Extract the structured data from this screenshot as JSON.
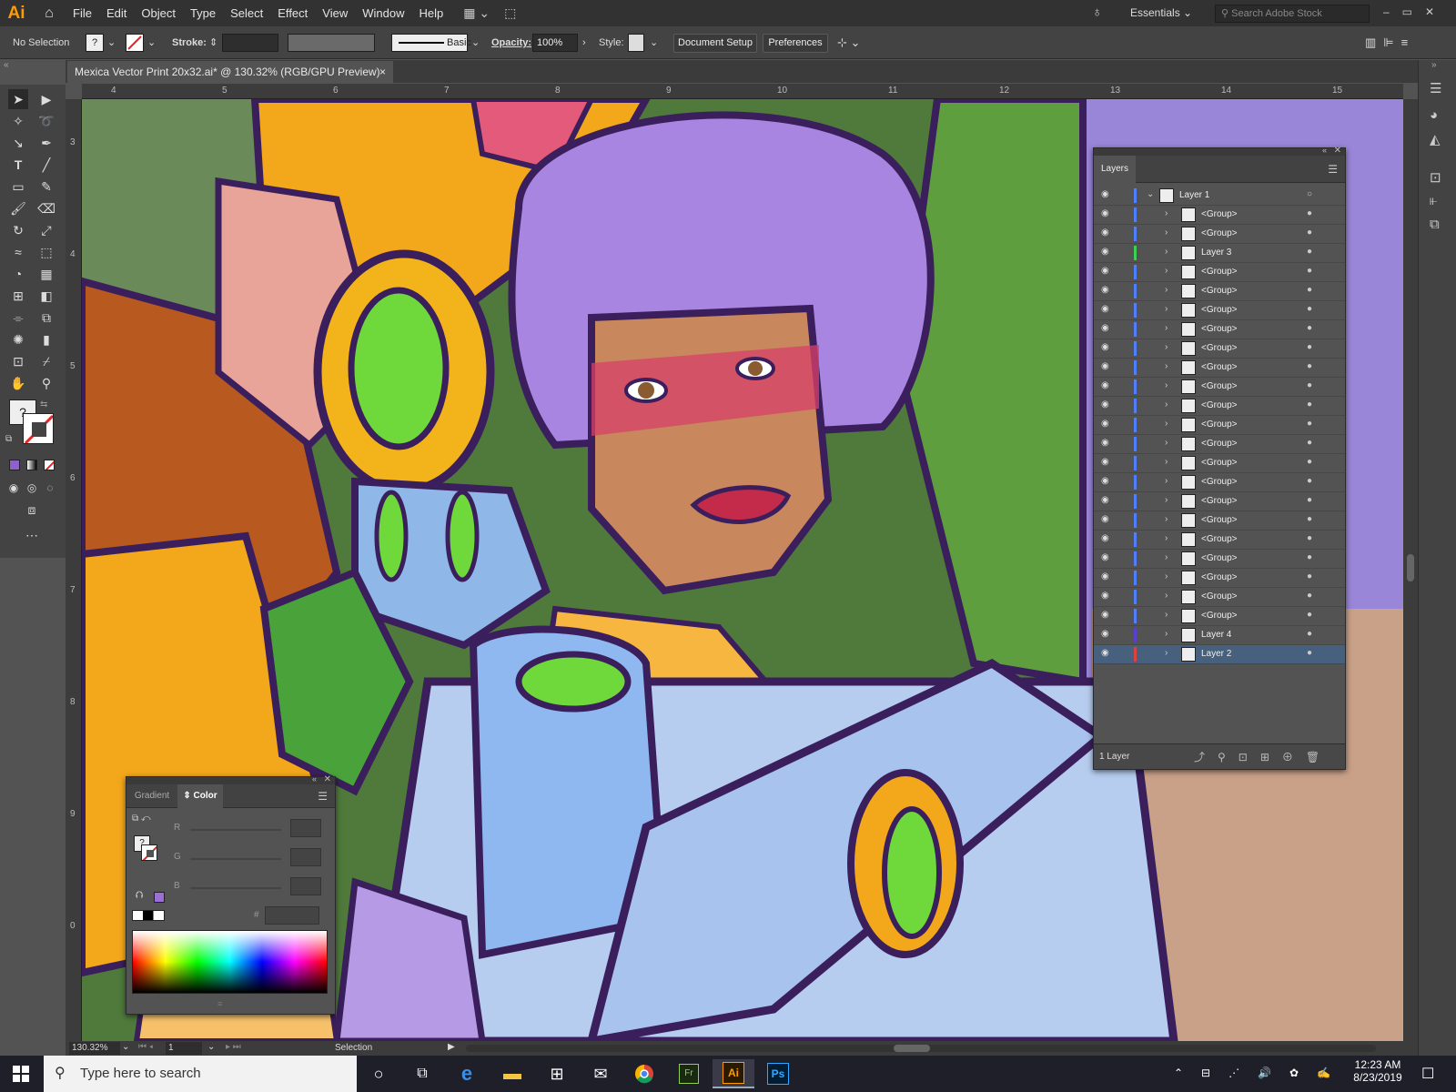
{
  "app": {
    "logo": "Ai",
    "accent": "#ff9a00"
  },
  "menu": [
    "File",
    "Edit",
    "Object",
    "Type",
    "Select",
    "Effect",
    "View",
    "Window",
    "Help"
  ],
  "workspace": {
    "label": "Essentials",
    "search_placeholder": "Search Adobe Stock"
  },
  "control": {
    "selection": "No Selection",
    "fill": "?",
    "stroke_label": "Stroke:",
    "brush": "Basic",
    "opacity_label": "Opacity:",
    "opacity": "100%",
    "style_label": "Style:",
    "doc_setup": "Document Setup",
    "preferences": "Preferences"
  },
  "document": {
    "tab": "Mexica Vector Print 20x32.ai* @ 130.32% (RGB/GPU Preview)",
    "close": "×"
  },
  "ruler_h": [
    "4",
    "5",
    "6",
    "7",
    "8",
    "9",
    "10",
    "11",
    "12",
    "13",
    "14",
    "15"
  ],
  "ruler_v": [
    "3",
    "4",
    "5",
    "6",
    "7",
    "8",
    "9",
    "0"
  ],
  "layers": {
    "tab": "Layers",
    "footer": "1 Layer",
    "rows": [
      {
        "name": "Layer 1",
        "color": "#4f7fff",
        "level": 0
      },
      {
        "name": "<Group>",
        "color": "#4f7fff",
        "level": 1
      },
      {
        "name": "<Group>",
        "color": "#4f7fff",
        "level": 1
      },
      {
        "name": "Layer 3",
        "color": "#3fd04f",
        "level": 1
      },
      {
        "name": "<Group>",
        "color": "#4f7fff",
        "level": 1
      },
      {
        "name": "<Group>",
        "color": "#4f7fff",
        "level": 1
      },
      {
        "name": "<Group>",
        "color": "#4f7fff",
        "level": 1
      },
      {
        "name": "<Group>",
        "color": "#4f7fff",
        "level": 1
      },
      {
        "name": "<Group>",
        "color": "#4f7fff",
        "level": 1
      },
      {
        "name": "<Group>",
        "color": "#4f7fff",
        "level": 1
      },
      {
        "name": "<Group>",
        "color": "#4f7fff",
        "level": 1
      },
      {
        "name": "<Group>",
        "color": "#4f7fff",
        "level": 1
      },
      {
        "name": "<Group>",
        "color": "#4f7fff",
        "level": 1
      },
      {
        "name": "<Group>",
        "color": "#4f7fff",
        "level": 1
      },
      {
        "name": "<Group>",
        "color": "#4f7fff",
        "level": 1
      },
      {
        "name": "<Group>",
        "color": "#4f7fff",
        "level": 1
      },
      {
        "name": "<Group>",
        "color": "#4f7fff",
        "level": 1
      },
      {
        "name": "<Group>",
        "color": "#4f7fff",
        "level": 1
      },
      {
        "name": "<Group>",
        "color": "#4f7fff",
        "level": 1
      },
      {
        "name": "<Group>",
        "color": "#4f7fff",
        "level": 1
      },
      {
        "name": "<Group>",
        "color": "#4f7fff",
        "level": 1
      },
      {
        "name": "<Group>",
        "color": "#4f7fff",
        "level": 1
      },
      {
        "name": "<Group>",
        "color": "#4f7fff",
        "level": 1
      },
      {
        "name": "Layer 4",
        "color": "#5a3fd0",
        "level": 1
      },
      {
        "name": "Layer 2",
        "color": "#e04040",
        "level": 1,
        "selected": true
      }
    ]
  },
  "color_panel": {
    "tab_gradient": "Gradient",
    "tab_color": "Color",
    "r": "R",
    "g": "G",
    "b": "B",
    "hash": "#",
    "swatch": "#9b6fd6"
  },
  "status": {
    "zoom": "130.32%",
    "artboard": "1",
    "tool": "Selection"
  },
  "taskbar": {
    "search_placeholder": "Type here to search",
    "time": "12:23 AM",
    "date": "8/23/2019"
  }
}
